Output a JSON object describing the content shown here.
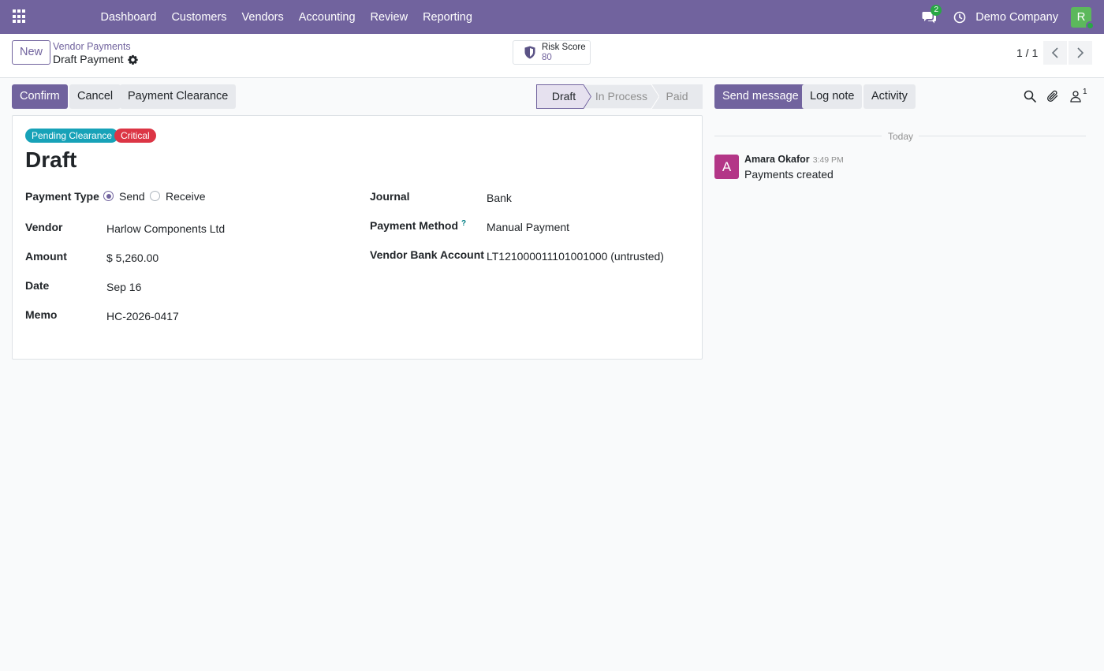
{
  "navbar": {
    "menu": [
      "Dashboard",
      "Customers",
      "Vendors",
      "Accounting",
      "Review",
      "Reporting"
    ],
    "chat_count": "2",
    "company": "Demo Company",
    "user_initial": "R"
  },
  "control_panel": {
    "new_label": "New",
    "breadcrumb": "Vendor Payments",
    "record_title": "Draft Payment",
    "risk_label": "Risk Score",
    "risk_value": "80",
    "pager": "1 / 1"
  },
  "actions": {
    "confirm": "Confirm",
    "cancel": "Cancel",
    "clearance": "Payment Clearance"
  },
  "statusbar": {
    "stages": [
      "Draft",
      "In Process",
      "Paid"
    ],
    "current": "Draft"
  },
  "form": {
    "tags": [
      "Pending Clearance",
      "Critical"
    ],
    "title": "Draft",
    "payment_type_label": "Payment Type",
    "payment_type_options": [
      "Send",
      "Receive"
    ],
    "payment_type_selected": "Send",
    "vendor_label": "Vendor",
    "vendor_value": "Harlow Components Ltd",
    "amount_label": "Amount",
    "amount_value": "$ 5,260.00",
    "date_label": "Date",
    "date_value": "Sep 16",
    "memo_label": "Memo",
    "memo_value": "HC-2026-0417",
    "journal_label": "Journal",
    "journal_value": "Bank",
    "method_label": "Payment Method",
    "method_help": "?",
    "method_value": "Manual Payment",
    "bank_label": "Vendor Bank Account",
    "bank_value": "LT121000011101001000 (untrusted)"
  },
  "chatter": {
    "send_message": "Send message",
    "log_note": "Log note",
    "activity": "Activity",
    "followers": "1",
    "date_separator": "Today",
    "messages": [
      {
        "initial": "A",
        "author": "Amara Okafor",
        "time": "3:49 PM",
        "body": "Payments created"
      }
    ]
  },
  "colors": {
    "brand": "#71639e",
    "tag_clearance": "#17a2b8",
    "tag_critical": "#dc3545",
    "avatar_user": "#5cb85c",
    "avatar_message": "#b33687"
  }
}
